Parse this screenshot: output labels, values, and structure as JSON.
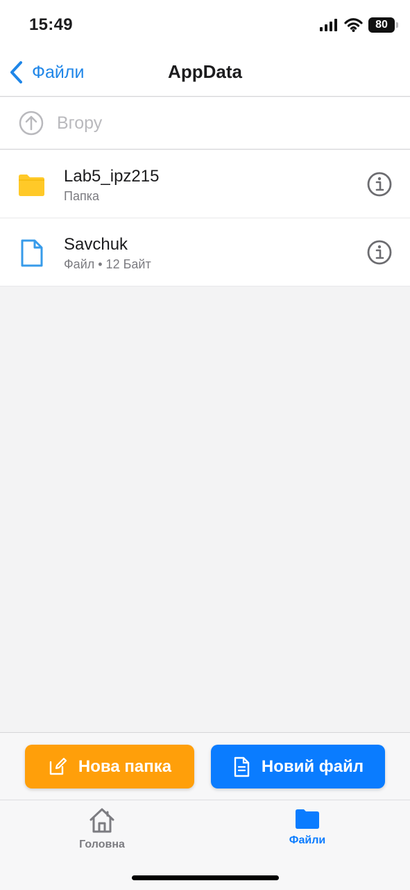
{
  "status": {
    "time": "15:49",
    "battery": "80"
  },
  "nav": {
    "back_label": "Файли",
    "title": "AppData"
  },
  "up_row": {
    "label": "Вгору"
  },
  "items": [
    {
      "name": "Lab5_ipz215",
      "meta": "Папка",
      "icon": "folder-icon"
    },
    {
      "name": "Savchuk",
      "meta": "Файл • 12 Байт",
      "icon": "document-icon"
    }
  ],
  "actions": {
    "new_folder": "Нова папка",
    "new_file": "Новий файл"
  },
  "tabs": [
    {
      "label": "Головна",
      "icon": "house-icon"
    },
    {
      "label": "Файли",
      "icon": "folder-icon"
    }
  ],
  "colors": {
    "accent_blue": "#0a7cff",
    "orange": "#ff9f0a",
    "folder_yellow": "#ffc928",
    "background": "#f3f3f4"
  }
}
